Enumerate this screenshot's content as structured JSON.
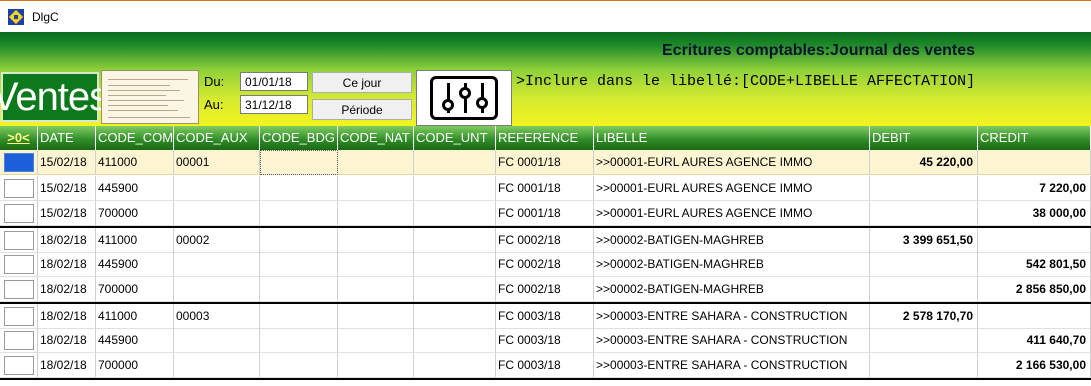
{
  "window": {
    "title": "DlgC"
  },
  "header": {
    "journal_title": "Ecritures comptables:Journal des ventes",
    "journal_label": "Ventes",
    "du_label": "Du:",
    "au_label": "Au:",
    "du_value": "01/01/18",
    "au_value": "31/12/18",
    "ce_jour_label": "Ce jour",
    "periode_label": "Période",
    "filter_icon": "sliders-icon",
    "include_text": ">Inclure dans le libellé:[CODE+LIBELLE AFFECTATION]"
  },
  "grid": {
    "columns": [
      "DATE",
      "CODE_COM",
      "CODE_AUX",
      "CODE_BDG",
      "CODE_NAT",
      "CODE_UNT",
      "REFERENCE",
      "LIBELLE",
      "DEBIT",
      "CREDIT"
    ],
    "selector_header": ">0<",
    "rows": [
      {
        "date": "15/02/18",
        "code_com": "411000",
        "code_aux": "00001",
        "reference": "FC 0001/18",
        "libelle": ">>00001-EURL AURES AGENCE IMMO",
        "debit": "45 220,00",
        "credit": ""
      },
      {
        "date": "15/02/18",
        "code_com": "445900",
        "code_aux": "",
        "reference": "FC 0001/18",
        "libelle": ">>00001-EURL AURES AGENCE IMMO",
        "debit": "",
        "credit": "7 220,00"
      },
      {
        "date": "15/02/18",
        "code_com": "700000",
        "code_aux": "",
        "reference": "FC 0001/18",
        "libelle": ">>00001-EURL AURES AGENCE IMMO",
        "debit": "",
        "credit": "38 000,00"
      },
      {
        "date": "18/02/18",
        "code_com": "411000",
        "code_aux": "00002",
        "reference": "FC 0002/18",
        "libelle": ">>00002-BATIGEN-MAGHREB",
        "debit": "3 399 651,50",
        "credit": ""
      },
      {
        "date": "18/02/18",
        "code_com": "445900",
        "code_aux": "",
        "reference": "FC 0002/18",
        "libelle": ">>00002-BATIGEN-MAGHREB",
        "debit": "",
        "credit": "542 801,50"
      },
      {
        "date": "18/02/18",
        "code_com": "700000",
        "code_aux": "",
        "reference": "FC 0002/18",
        "libelle": ">>00002-BATIGEN-MAGHREB",
        "debit": "",
        "credit": "2 856 850,00"
      },
      {
        "date": "18/02/18",
        "code_com": "411000",
        "code_aux": "00003",
        "reference": "FC 0003/18",
        "libelle": ">>00003-ENTRE SAHARA - CONSTRUCTION",
        "debit": "2 578 170,70",
        "credit": ""
      },
      {
        "date": "18/02/18",
        "code_com": "445900",
        "code_aux": "",
        "reference": "FC 0003/18",
        "libelle": ">>00003-ENTRE SAHARA - CONSTRUCTION",
        "debit": "",
        "credit": "411 640,70"
      },
      {
        "date": "18/02/18",
        "code_com": "700000",
        "code_aux": "",
        "reference": "FC 0003/18",
        "libelle": ">>00003-ENTRE SAHARA - CONSTRUCTION",
        "debit": "",
        "credit": "2 166 530,00"
      }
    ]
  }
}
